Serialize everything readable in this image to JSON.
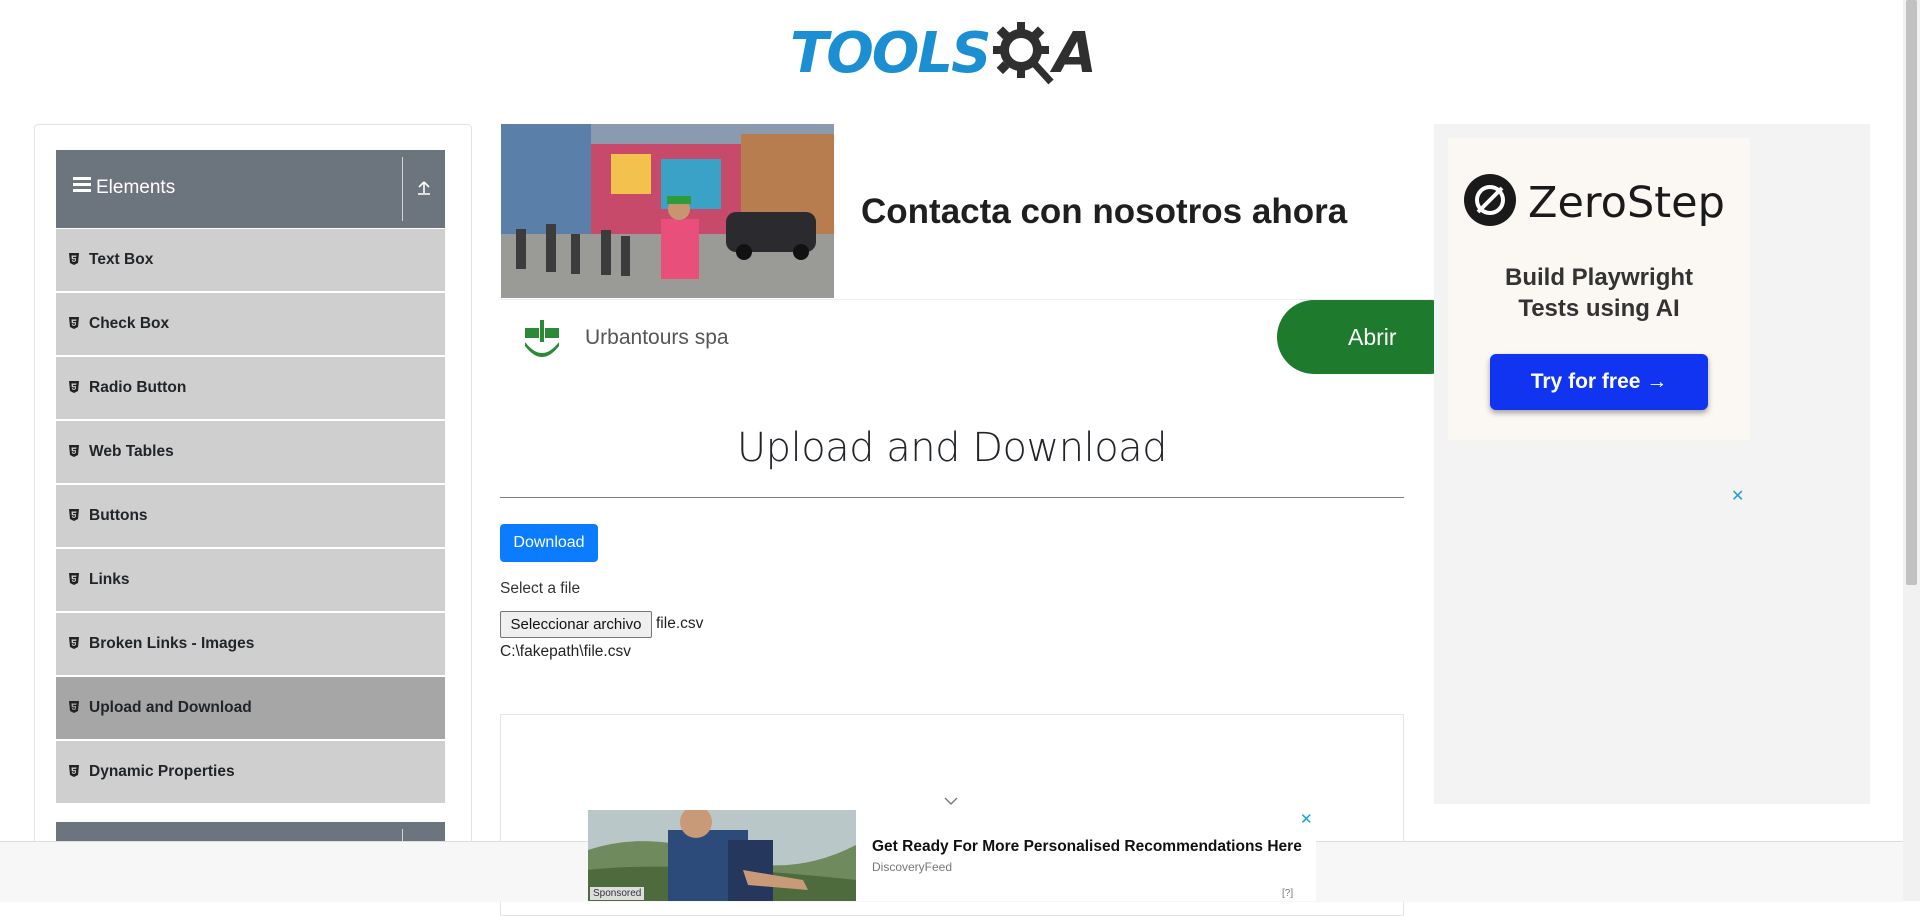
{
  "header": {
    "logo_tools": "TOOLS",
    "logo_qa": "A"
  },
  "sidebar": {
    "group_title": "Elements",
    "items": [
      {
        "label": "Text Box"
      },
      {
        "label": "Check Box"
      },
      {
        "label": "Radio Button"
      },
      {
        "label": "Web Tables"
      },
      {
        "label": "Buttons"
      },
      {
        "label": "Links"
      },
      {
        "label": "Broken Links - Images"
      },
      {
        "label": "Upload and Download",
        "active": true
      },
      {
        "label": "Dynamic Properties"
      }
    ]
  },
  "top_ad": {
    "headline": "Contacta con nosotros ahora",
    "brand": "Urbantours spa",
    "cta": "Abrir",
    "cta_color": "#1e7a2c"
  },
  "main": {
    "title": "Upload and Download",
    "download_label": "Download",
    "select_label": "Select a file",
    "file_button_label": "Seleccionar archivo",
    "file_name": "file.csv",
    "uploaded_path": "C:\\fakepath\\file.csv"
  },
  "right_ad": {
    "brand": "ZeroStep",
    "tagline_1": "Build Playwright",
    "tagline_2": "Tests using AI",
    "cta": "Try for free →",
    "cta_color": "#1034f0",
    "close": "✕"
  },
  "bottom_ad": {
    "title": "Get Ready For More Personalised Recommendations Here",
    "source": "DiscoveryFeed",
    "sponsored": "Sponsored",
    "info": "[?]",
    "close": "✕"
  },
  "colors": {
    "sidebar_header": "#6c757d",
    "menu_item": "#cfcfcf",
    "menu_active": "#a6a6a6",
    "download_button": "#0b7cff"
  }
}
